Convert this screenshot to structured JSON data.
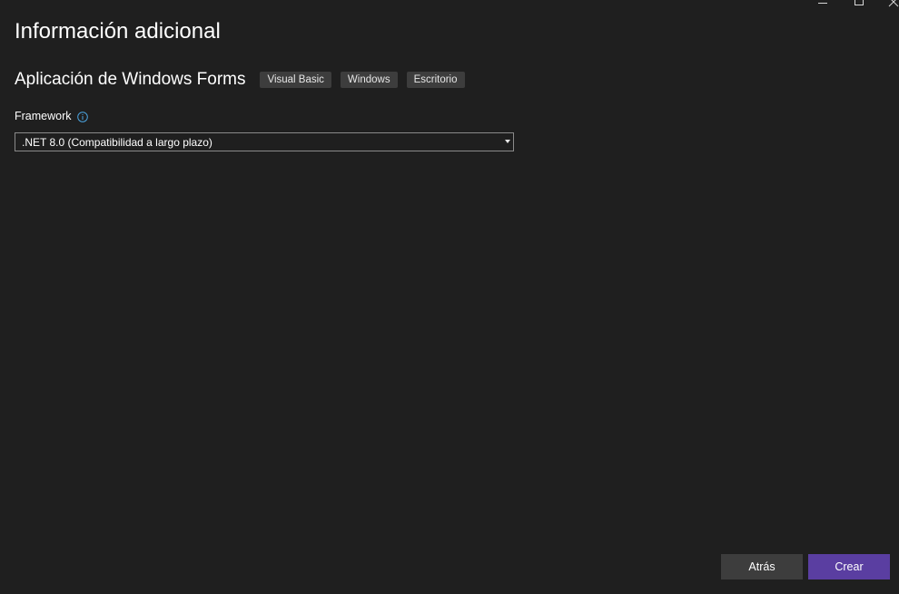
{
  "window": {
    "controls": {
      "minimize_icon": "minimize-icon",
      "maximize_icon": "maximize-icon",
      "close_icon": "close-icon"
    }
  },
  "page": {
    "title": "Información adicional",
    "project_name": "Aplicación de Windows Forms",
    "tags": [
      "Visual Basic",
      "Windows",
      "Escritorio"
    ]
  },
  "framework": {
    "label": "Framework",
    "info_icon": "info-icon",
    "selected": ".NET 8.0 (Compatibilidad a largo plazo)"
  },
  "footer": {
    "back_label": "Atrás",
    "create_label": "Crear"
  },
  "colors": {
    "background": "#1f1f1f",
    "accent": "#5a3ea1",
    "secondary_button": "#3d3d3d",
    "info": "#4ca4e0"
  }
}
